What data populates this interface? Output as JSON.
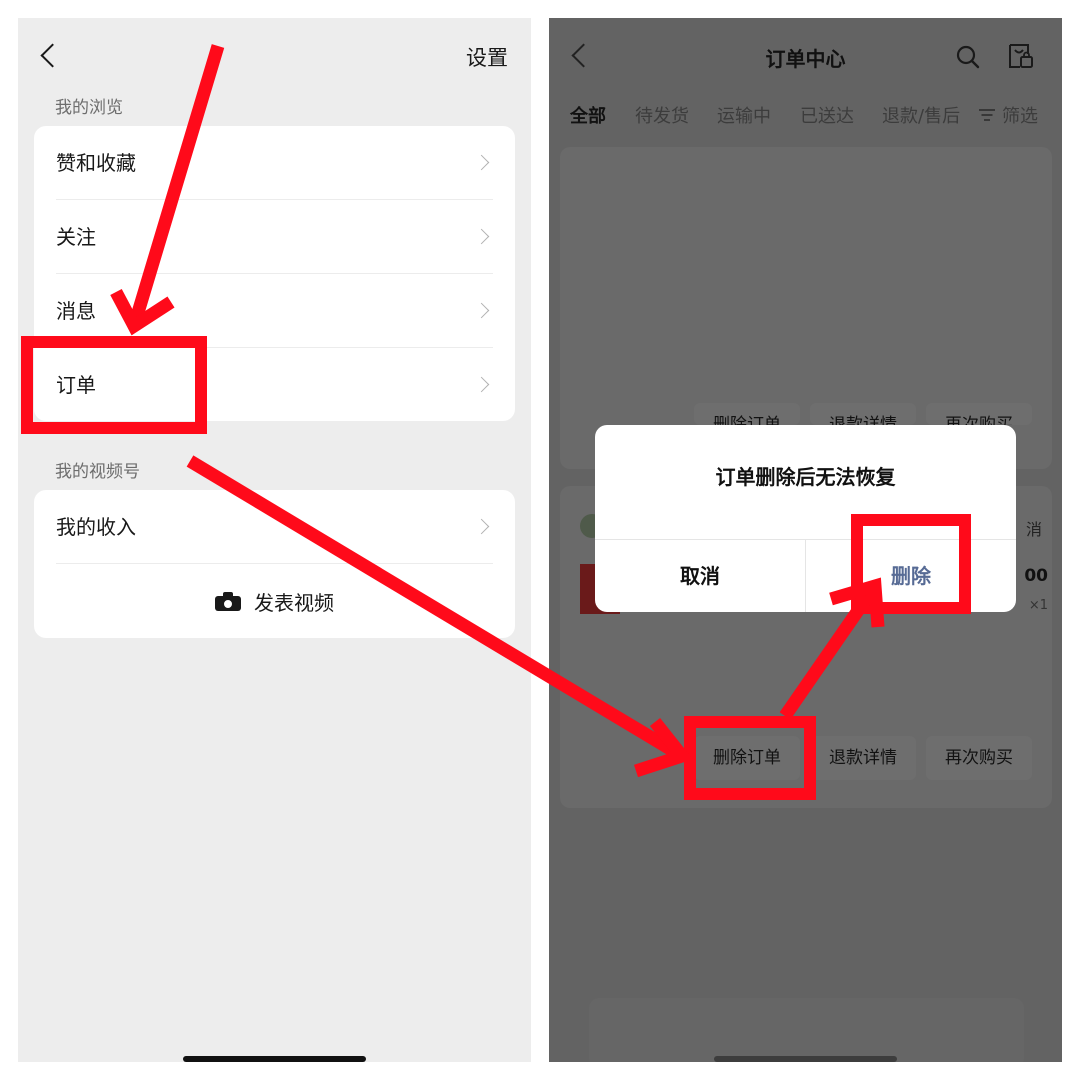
{
  "left_screen": {
    "header": {
      "back_icon": "chevron-left-icon",
      "settings_label": "设置"
    },
    "sections": [
      {
        "label": "我的浏览",
        "items": [
          {
            "label": "赞和收藏"
          },
          {
            "label": "关注"
          },
          {
            "label": "消息"
          },
          {
            "label": "订单"
          }
        ]
      },
      {
        "label": "我的视频号",
        "items": [
          {
            "label": "我的收入"
          }
        ],
        "publish": {
          "icon": "camera-icon",
          "label": "发表视频"
        }
      }
    ]
  },
  "right_screen": {
    "header": {
      "back_icon": "chevron-left-icon",
      "title": "订单中心",
      "search_icon": "search-icon",
      "bag_icon": "shopping-bag-icon"
    },
    "tabs": [
      {
        "label": "全部",
        "active": true
      },
      {
        "label": "待发货"
      },
      {
        "label": "运输中"
      },
      {
        "label": "已送达"
      },
      {
        "label": "退款/售后"
      }
    ],
    "filter": {
      "icon": "filter-icon",
      "label": "筛选"
    },
    "order_card_1": {
      "buttons": [
        "删除订单",
        "退款详情",
        "再次购买"
      ]
    },
    "order_card_2": {
      "status_fragment": "消",
      "price_fragment": "00",
      "quantity_fragment": "×1",
      "buttons": [
        "删除订单",
        "退款详情",
        "再次购买"
      ]
    },
    "dialog": {
      "title": "订单删除后无法恢复",
      "cancel_label": "取消",
      "confirm_label": "删除"
    }
  },
  "colors": {
    "annotation_red": "#ff0a1a",
    "dialog_confirm_blue": "#576b95",
    "left_background": "#ededed",
    "overlay_gray": "#636363"
  }
}
